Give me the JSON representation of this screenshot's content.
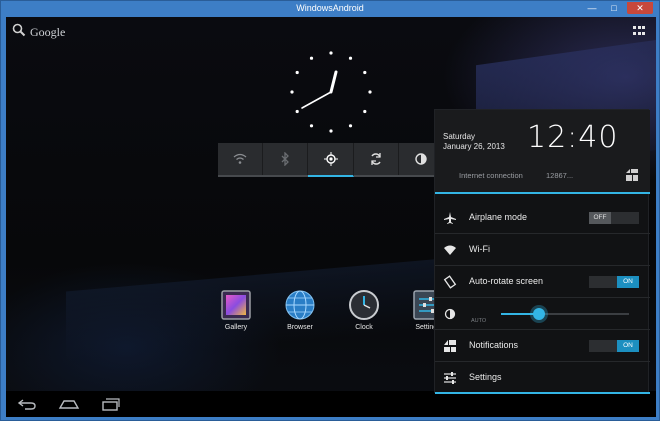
{
  "window": {
    "title": "WindowsAndroid"
  },
  "search": {
    "label": "Google"
  },
  "toggles": {
    "items": [
      {
        "icon": "wifi-icon",
        "active": false
      },
      {
        "icon": "bluetooth-icon",
        "active": false
      },
      {
        "icon": "location-icon",
        "active": true
      },
      {
        "icon": "sync-icon",
        "active": false
      },
      {
        "icon": "brightness-icon",
        "active": false
      }
    ]
  },
  "apps": [
    {
      "label": "Gallery"
    },
    {
      "label": "Browser"
    },
    {
      "label": "Clock"
    },
    {
      "label": "Settings"
    }
  ],
  "panel": {
    "day": "Saturday",
    "date": "January 26, 2013",
    "time": "12:40",
    "connection_label": "Internet connection",
    "connection_value": "12867...",
    "rows": {
      "airplane": {
        "label": "Airplane mode",
        "state": "OFF"
      },
      "wifi": {
        "label": "Wi-Fi"
      },
      "rotate": {
        "label": "Auto-rotate screen",
        "state": "ON"
      },
      "brightness": {
        "auto_label": "AUTO",
        "level": 0.3
      },
      "notifications": {
        "label": "Notifications",
        "state": "ON"
      },
      "settings": {
        "label": "Settings"
      }
    }
  },
  "colors": {
    "accent": "#33b5e5",
    "titlebar": "#3d7ec6",
    "close": "#c7483b"
  }
}
